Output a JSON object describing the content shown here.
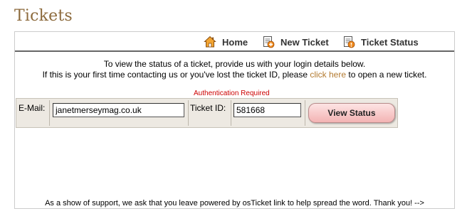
{
  "page": {
    "title": "Tickets"
  },
  "nav": {
    "items": [
      {
        "label": "Home",
        "icon": "home-icon"
      },
      {
        "label": "New Ticket",
        "icon": "new-ticket-icon"
      },
      {
        "label": "Ticket Status",
        "icon": "ticket-status-icon"
      }
    ]
  },
  "intro": {
    "line1": "To view the status of a ticket, provide us with your login details below.",
    "line2_prefix": "If this is your first time contacting us or you've lost the ticket ID, please ",
    "line2_link": "click here",
    "line2_suffix": " to open a new ticket."
  },
  "auth": {
    "message": "Authentication Required"
  },
  "form": {
    "email_label": "E-Mail:",
    "email_value": "janetmerseymag.co.uk",
    "ticket_label": "Ticket ID:",
    "ticket_value": "581668",
    "submit_label": "View Status"
  },
  "footer": {
    "note": "As a show of support, we ask that you leave powered by osTicket link to help spread the word. Thank you! -->"
  },
  "colors": {
    "title": "#8c6a3c",
    "link": "#b37a30",
    "error": "#cc0000",
    "button": "#f3b3b3"
  }
}
